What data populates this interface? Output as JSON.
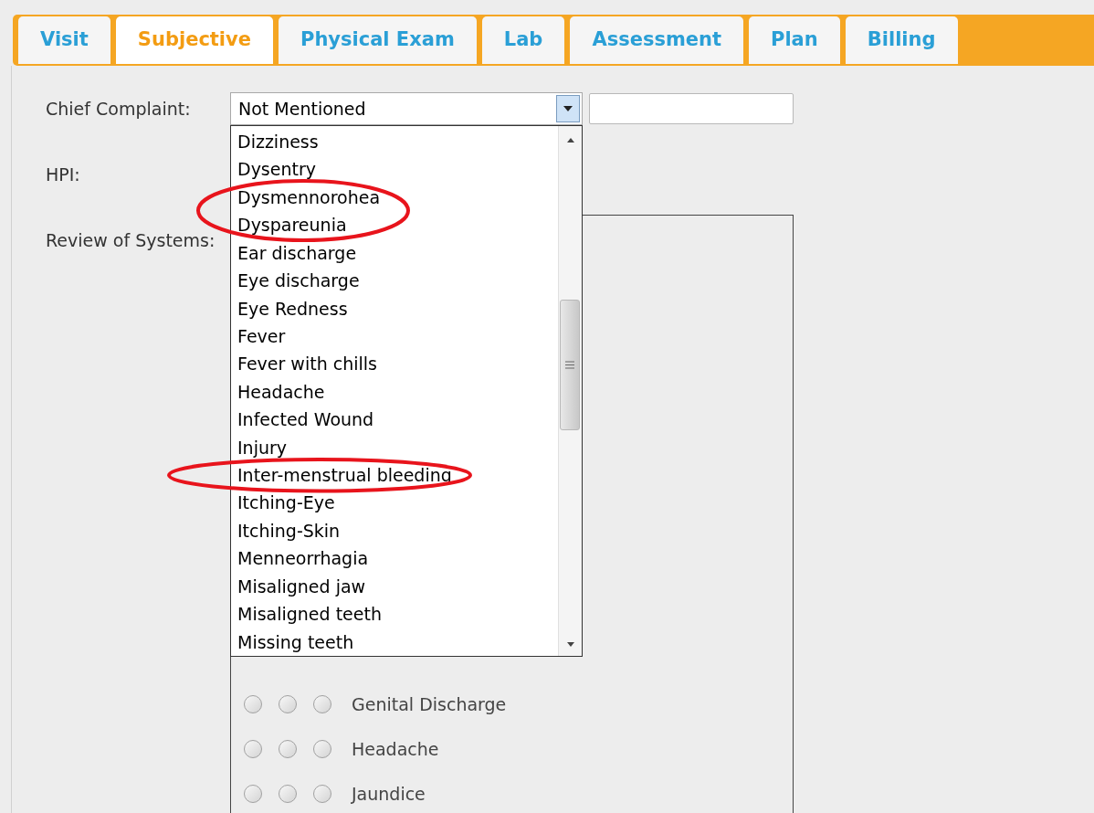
{
  "tabs": [
    {
      "label": "Visit",
      "selected": false
    },
    {
      "label": "Subjective",
      "selected": true
    },
    {
      "label": "Physical Exam",
      "selected": false
    },
    {
      "label": "Lab",
      "selected": false
    },
    {
      "label": "Assessment",
      "selected": false
    },
    {
      "label": "Plan",
      "selected": false
    },
    {
      "label": "Billing",
      "selected": false
    }
  ],
  "chief_complaint": {
    "label": "Chief Complaint:",
    "value": "Not Mentioned",
    "expanded": true,
    "options": [
      {
        "label": "Dizziness",
        "circled": false
      },
      {
        "label": "Dysentry",
        "circled": false
      },
      {
        "label": "Dysmennorohea",
        "circled": true
      },
      {
        "label": "Dyspareunia",
        "circled": true
      },
      {
        "label": "Ear discharge",
        "circled": false
      },
      {
        "label": "Eye discharge",
        "circled": false
      },
      {
        "label": "Eye Redness",
        "circled": false
      },
      {
        "label": "Fever",
        "circled": false
      },
      {
        "label": "Fever with chills",
        "circled": false
      },
      {
        "label": "Headache",
        "circled": false
      },
      {
        "label": "Infected Wound",
        "circled": false
      },
      {
        "label": "Injury",
        "circled": false
      },
      {
        "label": "Inter-menstrual bleeding",
        "circled": true
      },
      {
        "label": "Itching-Eye",
        "circled": false
      },
      {
        "label": "Itching-Skin",
        "circled": false
      },
      {
        "label": "Menneorrhagia",
        "circled": false
      },
      {
        "label": "Misaligned jaw",
        "circled": false
      },
      {
        "label": "Misaligned teeth",
        "circled": false
      },
      {
        "label": "Missing teeth",
        "circled": false
      }
    ]
  },
  "hpi": {
    "label": "HPI:"
  },
  "review_of_systems": {
    "label": "Review of Systems:",
    "rows": [
      {
        "label": "Genital Discharge",
        "choices": [
          {
            "checked": false
          },
          {
            "checked": false
          },
          {
            "checked": false
          }
        ]
      },
      {
        "label": "Headache",
        "choices": [
          {
            "checked": false
          },
          {
            "checked": false
          },
          {
            "checked": false
          }
        ]
      },
      {
        "label": "Jaundice",
        "choices": [
          {
            "checked": false
          },
          {
            "checked": false
          },
          {
            "checked": false
          }
        ]
      }
    ]
  }
}
